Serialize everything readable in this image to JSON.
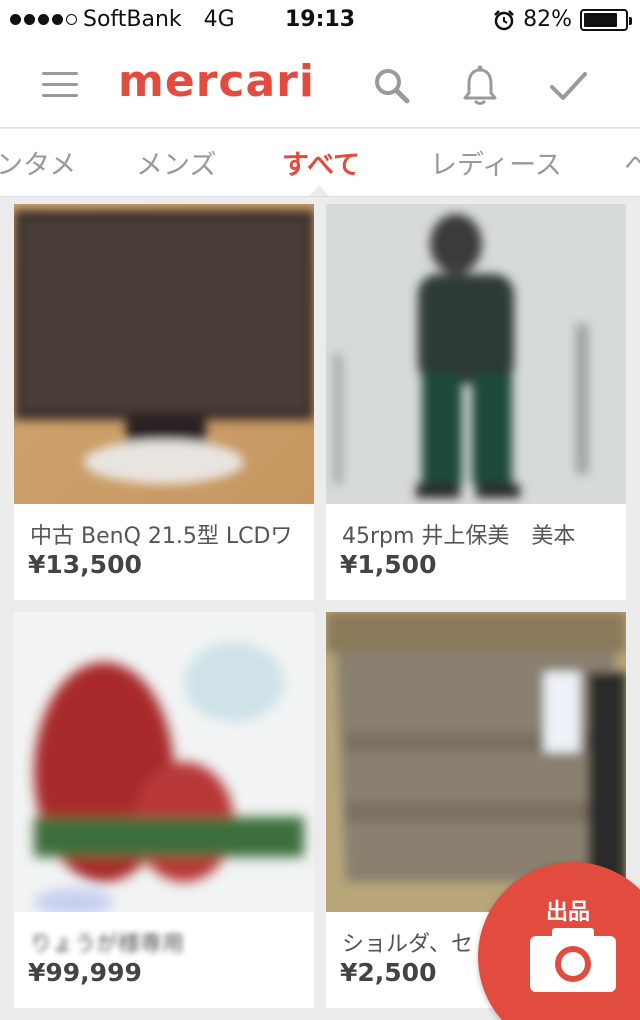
{
  "status_bar": {
    "carrier": "SoftBank",
    "network": "4G",
    "time": "19:13",
    "battery": "82%",
    "battery_level": 0.82,
    "signal_bars_filled": 4,
    "signal_bars_total": 5
  },
  "header": {
    "logo": "mercari",
    "brand_color": "#e24c3f",
    "icons": [
      "menu-icon",
      "search-icon",
      "bell-icon",
      "check-icon"
    ]
  },
  "tabs": [
    {
      "label": "ンタメ",
      "active": false
    },
    {
      "label": "メンズ",
      "active": false
    },
    {
      "label": "すべて",
      "active": true
    },
    {
      "label": "レディース",
      "active": false
    },
    {
      "label": "ヘ",
      "active": false
    }
  ],
  "items": [
    {
      "title": "中古 BenQ 21.5型 LCDワ",
      "price": "¥13,500"
    },
    {
      "title": "45rpm 井上保美　美本",
      "price": "¥1,500"
    },
    {
      "title": "りょうが様専用",
      "price": "¥99,999"
    },
    {
      "title": "ショルダ、セ",
      "price": "¥2,500"
    }
  ],
  "fab": {
    "label": "出品",
    "icon": "camera-icon"
  }
}
